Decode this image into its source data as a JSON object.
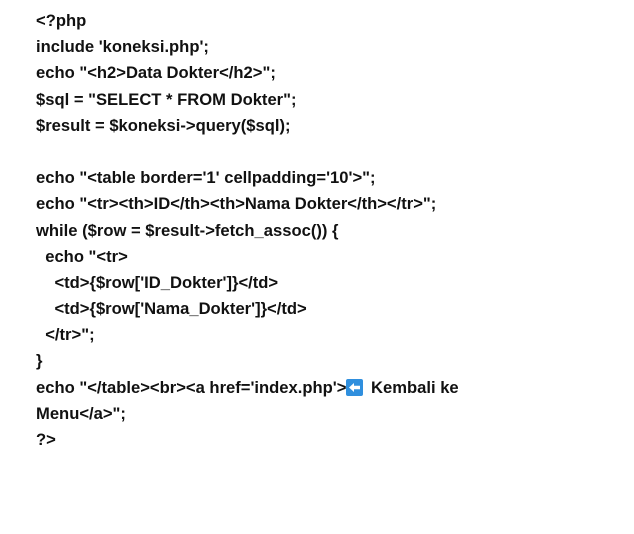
{
  "code": {
    "lines": [
      "<?php",
      "include 'koneksi.php';",
      "echo \"<h2>Data Dokter</h2>\";",
      "$sql = \"SELECT * FROM Dokter\";",
      "$result = $koneksi->query($sql);",
      "",
      "echo \"<table border='1' cellpadding='10'>\";",
      "echo \"<tr><th>ID</th><th>Nama Dokter</th></tr>\";",
      "while ($row = $result->fetch_assoc()) {",
      "  echo \"<tr>",
      "    <td>{$row['ID_Dokter']}</td>",
      "    <td>{$row['Nama_Dokter']}</td>",
      "  </tr>\";",
      "}"
    ],
    "back_line_prefix": "echo \"</table><br><a href='index.php'>",
    "back_line_suffix": " Kembali ke",
    "back_line_continued": "Menu</a>\";",
    "closing_tag": "?>"
  },
  "icons": {
    "back_arrow": "left-arrow-icon",
    "back_arrow_color": "#2f8fde"
  }
}
